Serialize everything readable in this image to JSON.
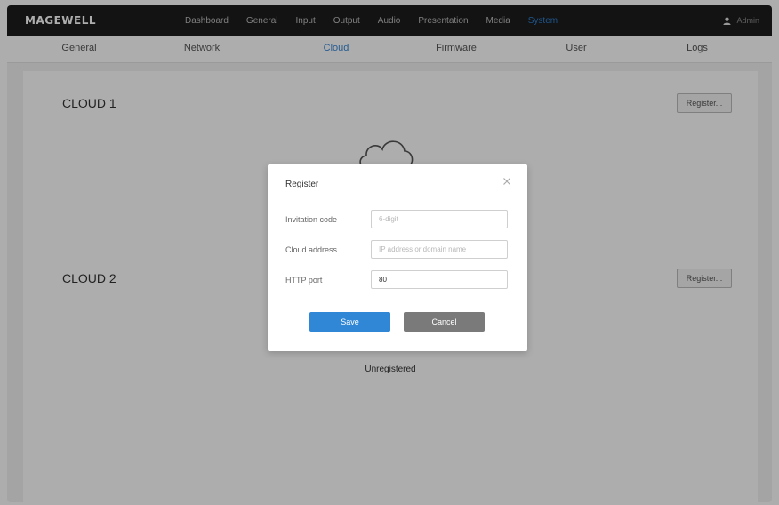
{
  "app": {
    "logo_text": "MAGEWELL"
  },
  "nav": {
    "items": [
      {
        "label": "Dashboard"
      },
      {
        "label": "General"
      },
      {
        "label": "Input"
      },
      {
        "label": "Output"
      },
      {
        "label": "Audio"
      },
      {
        "label": "Presentation"
      },
      {
        "label": "Media"
      },
      {
        "label": "System"
      }
    ],
    "active": "System",
    "user_label": "Admin"
  },
  "subtabs": {
    "items": [
      {
        "label": "General"
      },
      {
        "label": "Network"
      },
      {
        "label": "Cloud"
      },
      {
        "label": "Firmware"
      },
      {
        "label": "User"
      },
      {
        "label": "Logs"
      }
    ],
    "active": "Cloud"
  },
  "clouds": [
    {
      "title": "CLOUD 1",
      "register_label": "Register..."
    },
    {
      "title": "CLOUD 2",
      "register_label": "Register..."
    }
  ],
  "status_text": "Unregistered",
  "modal": {
    "title": "Register",
    "fields": [
      {
        "label": "Invitation code",
        "placeholder": "6-digit",
        "value": ""
      },
      {
        "label": "Cloud address",
        "placeholder": "IP address or domain name",
        "value": ""
      },
      {
        "label": "HTTP port",
        "placeholder": "",
        "value": "80"
      }
    ],
    "save_label": "Save",
    "cancel_label": "Cancel"
  },
  "colors": {
    "accent": "#2f87d6",
    "topbar": "#1c1c1c",
    "cancel": "#7a7a7a"
  }
}
